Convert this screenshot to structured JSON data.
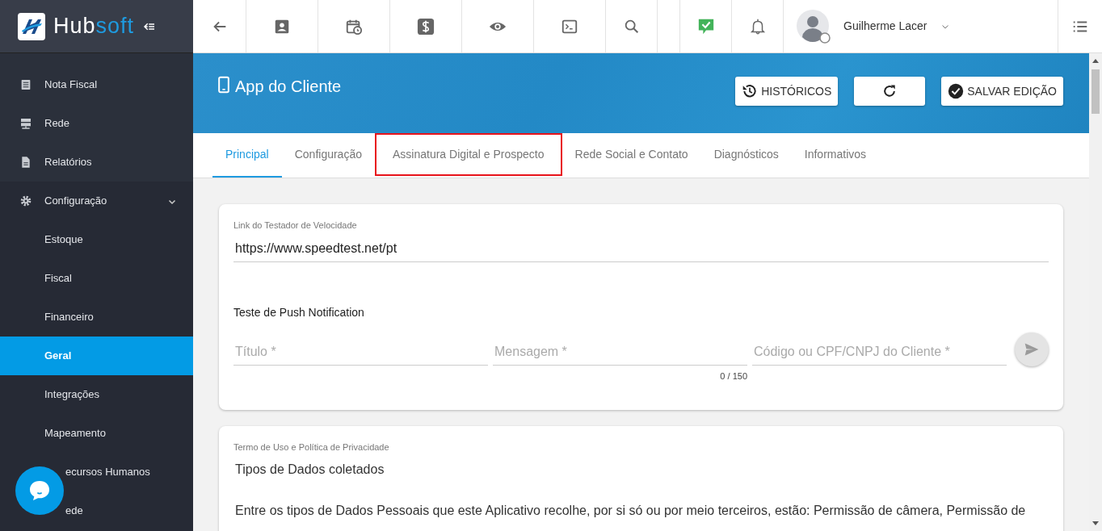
{
  "brand": {
    "name_part1": "Hub",
    "name_part2": "soft"
  },
  "user": {
    "name": "Guilherme Lacer"
  },
  "sidebar": {
    "items": [
      {
        "label": "Nota Fiscal",
        "selected": false
      },
      {
        "label": "Rede",
        "selected": false
      },
      {
        "label": "Relatórios",
        "selected": false
      },
      {
        "label": "Configuração",
        "selected": false,
        "expanded": true,
        "children": [
          {
            "label": "Estoque",
            "selected": false
          },
          {
            "label": "Fiscal",
            "selected": false
          },
          {
            "label": "Financeiro",
            "selected": false
          },
          {
            "label": "Geral",
            "selected": true
          },
          {
            "label": "Integrações",
            "selected": false
          },
          {
            "label": "Mapeamento",
            "selected": false
          },
          {
            "label": "ecursos Humanos",
            "selected": false
          },
          {
            "label": "ede",
            "selected": false
          }
        ]
      }
    ]
  },
  "page": {
    "title": "App do Cliente",
    "buttons": [
      {
        "label": "HISTÓRICOS",
        "kind": "history"
      },
      {
        "kind": "refresh"
      },
      {
        "label": "SALVAR EDIÇÃO",
        "kind": "save"
      }
    ]
  },
  "tabs": [
    {
      "label": "Principal",
      "selected": true,
      "highlighted": false
    },
    {
      "label": "Configuração",
      "selected": false,
      "highlighted": false
    },
    {
      "label": "Assinatura Digital e Prospecto",
      "selected": false,
      "highlighted": true
    },
    {
      "label": "Rede Social e Contato",
      "selected": false,
      "highlighted": false
    },
    {
      "label": "Diagnósticos",
      "selected": false,
      "highlighted": false
    },
    {
      "label": "Informativos",
      "selected": false,
      "highlighted": false
    }
  ],
  "speed_test": {
    "label": "Link do Testador de Velocidade",
    "value": "https://www.speedtest.net/pt"
  },
  "push_test": {
    "title": "Teste de Push Notification",
    "fields": [
      {
        "placeholder": "Título *"
      },
      {
        "placeholder": "Mensagem *",
        "counter": "0 / 150"
      },
      {
        "placeholder": "Código ou CPF/CNPJ do Cliente *"
      }
    ],
    "send_disabled": true
  },
  "terms": {
    "label": "Termo de Uso e Política de Privacidade",
    "paragraphs": [
      "Tipos de Dados coletados",
      "Entre os tipos de Dados Pessoais que este Aplicativo recolhe, por si só ou por meio terceiros, estão: Permissão de câmera, Permissão de"
    ]
  }
}
